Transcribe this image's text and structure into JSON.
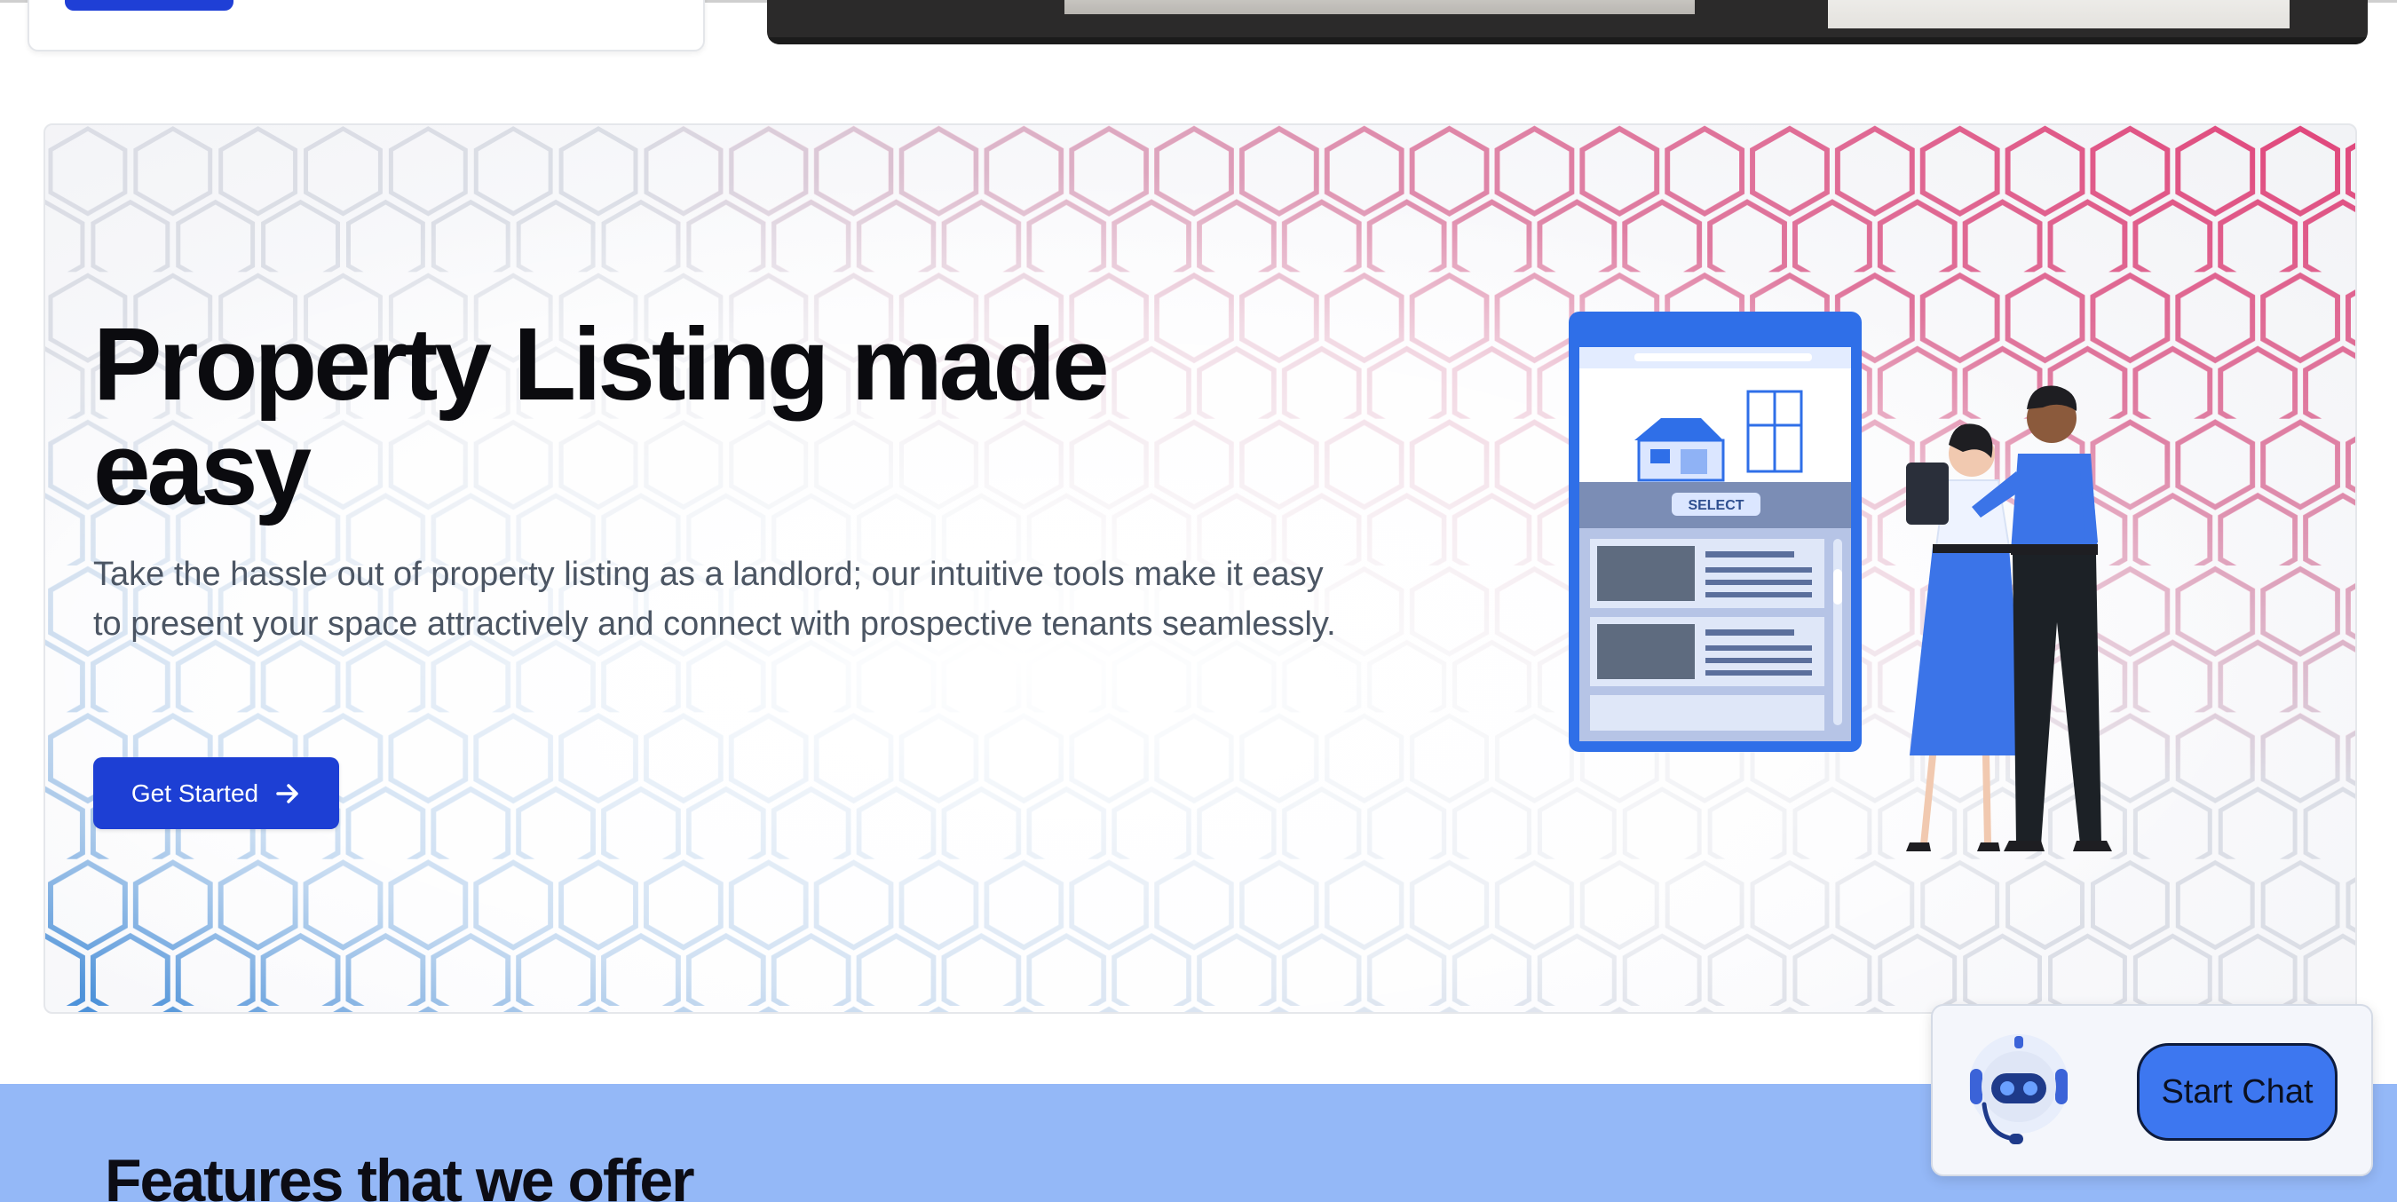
{
  "hero": {
    "title": "Property Listing made easy",
    "description": "Take the hassle out of property listing as a landlord; our intuitive tools make it easy to present your space attractively and connect with prospective tenants seamlessly.",
    "cta_label": "Get Started",
    "illustration": {
      "select_label": "SELECT"
    }
  },
  "features": {
    "title": "Features that we offer"
  },
  "chat_widget": {
    "button_label": "Start Chat"
  },
  "colors": {
    "primary": "#1d3fd4",
    "features_band": "#94b8f7",
    "chat_button": "#3d77f0",
    "hex_pink": "#e0457a",
    "hex_blue": "#4a90d9"
  },
  "icons": {
    "cta_icon": "arrow-right-icon",
    "chat_avatar": "robot-icon"
  }
}
